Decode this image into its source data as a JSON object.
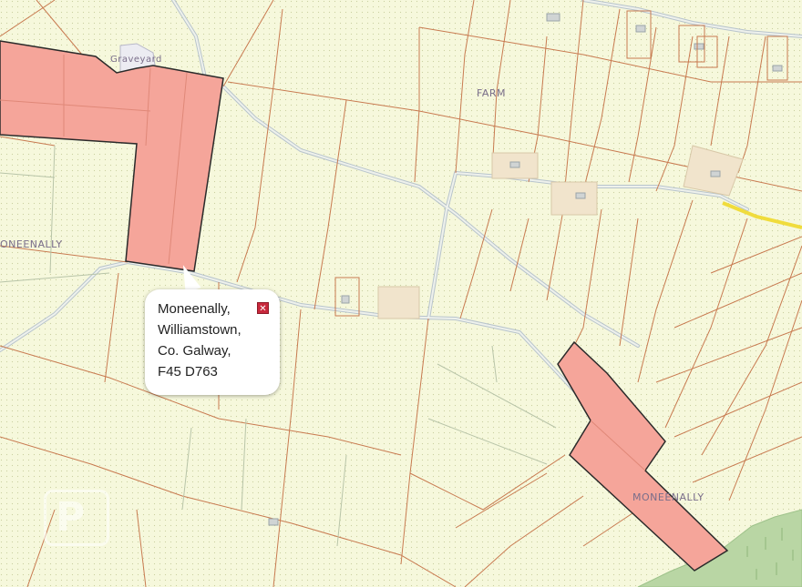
{
  "map": {
    "labels": {
      "graveyard": "Graveyard",
      "farm": "FARM",
      "townland_left": "ONEENALLY",
      "townland_right": "MONEENALLY"
    },
    "colors": {
      "background": "#f6f8dc",
      "field_boundary": "#c87a50",
      "road": "#b8c4cc",
      "highlight_fill": "#f5a59a",
      "highlight_border": "#2a2a2a",
      "yellow_road": "#f0dc3c",
      "woodland": "#b9d6a4"
    }
  },
  "popup": {
    "lines": [
      "Moneenally,",
      "Williamstown,",
      "Co. Galway,",
      "F45 D763"
    ],
    "close_icon": "close-icon"
  },
  "watermark": {
    "text": "P"
  }
}
